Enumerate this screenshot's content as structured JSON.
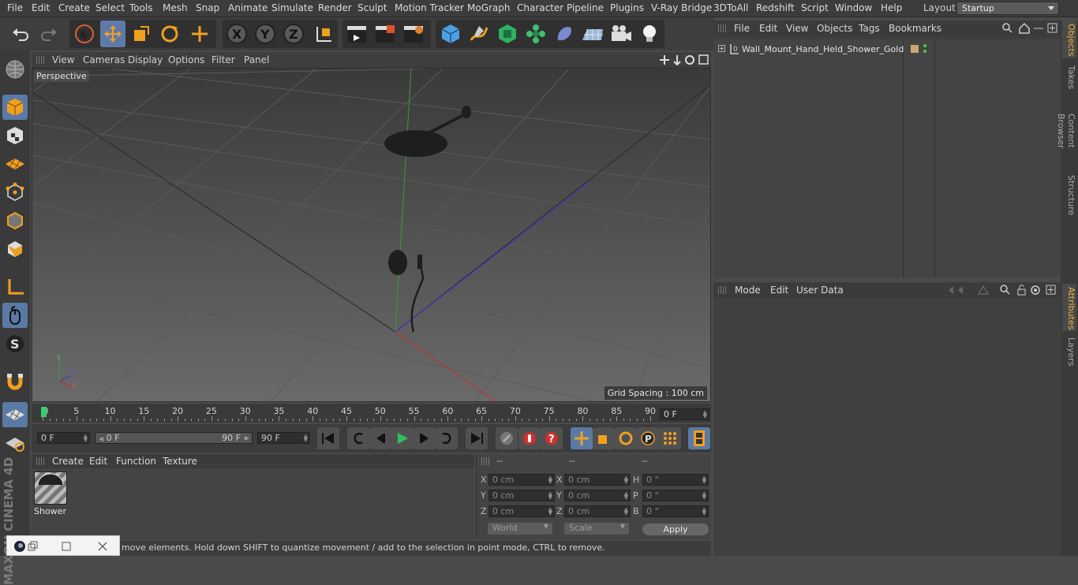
{
  "menubar": {
    "items": [
      "File",
      "Edit",
      "Create",
      "Select",
      "Tools",
      "Mesh",
      "Snap",
      "Animate",
      "Simulate",
      "Render",
      "Sculpt",
      "Motion Tracker",
      "MoGraph",
      "Character",
      "Pipeline",
      "Plugins",
      "V-Ray Bridge",
      "3DToAll",
      "Redshift",
      "Script",
      "Window",
      "Help"
    ],
    "layout_label": "Layout:",
    "layout_value": "Startup"
  },
  "viewport": {
    "menu": [
      "View",
      "Cameras",
      "Display",
      "Options",
      "Filter",
      "Panel"
    ],
    "camera_label": "Perspective",
    "grid_spacing": "Grid Spacing : 100 cm"
  },
  "timeline": {
    "labels": [
      "0",
      "5",
      "10",
      "15",
      "20",
      "25",
      "30",
      "35",
      "40",
      "45",
      "50",
      "55",
      "60",
      "65",
      "70",
      "75",
      "80",
      "85",
      "90"
    ],
    "current_frame": "0 F"
  },
  "transport": {
    "start": "0 F",
    "range_start": "0 F",
    "range_end": "90 F",
    "end": "90 F"
  },
  "materials": {
    "menu": [
      "Create",
      "Edit",
      "Function",
      "Texture"
    ],
    "items": [
      {
        "name": "Shower"
      }
    ]
  },
  "coords": {
    "headers": [
      "--",
      "--",
      "--"
    ],
    "col1_labels": [
      "X",
      "Y",
      "Z"
    ],
    "col1_values": [
      "0 cm",
      "0 cm",
      "0 cm"
    ],
    "col2_labels": [
      "X",
      "Y",
      "Z"
    ],
    "col2_values": [
      "0 cm",
      "0 cm",
      "0 cm"
    ],
    "col3_labels": [
      "H",
      "P",
      "B"
    ],
    "col3_values": [
      "0 °",
      "0 °",
      "0 °"
    ],
    "mode_world": "World",
    "mode_scale": "Scale",
    "apply": "Apply"
  },
  "status": "move elements. Hold down SHIFT to quantize movement / add to the selection in point mode, CTRL to remove.",
  "objects": {
    "menu": [
      "File",
      "Edit",
      "View",
      "Objects",
      "Tags",
      "Bookmarks"
    ],
    "tree": [
      {
        "name": "Wall_Mount_Hand_Held_Shower_Gold",
        "tag_color": "#c8a870"
      }
    ]
  },
  "attributes": {
    "menu": [
      "Mode",
      "Edit",
      "User Data"
    ]
  },
  "right_tabs": [
    "Objects",
    "Takes",
    "Content Browser",
    "Structure",
    "Attributes",
    "Layers"
  ],
  "branding": "MAXON CINEMA 4D",
  "colors": {
    "selection_blue": "#5a7aa6",
    "active_tab": "#f0b23d",
    "playhead": "#35d06b"
  }
}
